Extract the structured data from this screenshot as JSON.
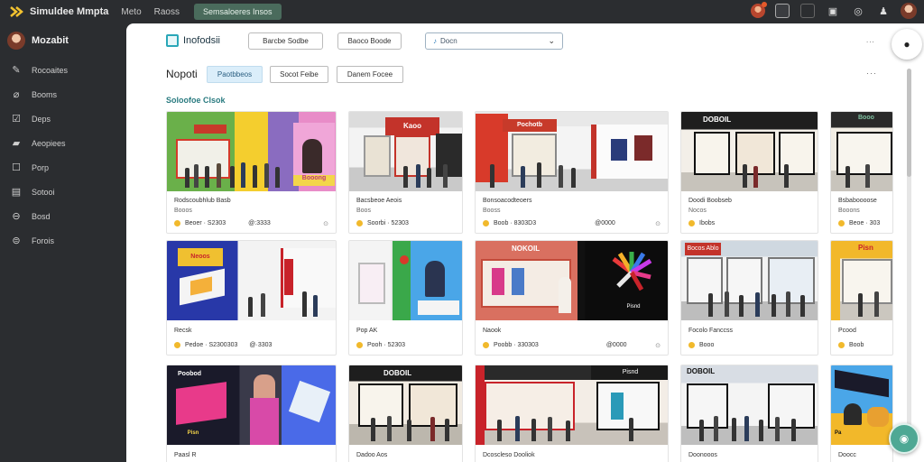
{
  "topbar": {
    "brand": "Simuldee Mmpta",
    "links": [
      "Meto",
      "Raoss"
    ],
    "pill": "Semsaloeres Insos"
  },
  "sidebar": {
    "user": "Mozabit",
    "items": [
      {
        "label": "Rocoaites",
        "icon": "edit-icon"
      },
      {
        "label": "Booms",
        "icon": "pin-icon"
      },
      {
        "label": "Deps",
        "icon": "checklist-icon"
      },
      {
        "label": "Aeopiees",
        "icon": "folder-icon"
      },
      {
        "label": "Porp",
        "icon": "square-icon"
      },
      {
        "label": "Sotooi",
        "icon": "calendar-icon"
      },
      {
        "label": "Bosd",
        "icon": "circle-icon"
      },
      {
        "label": "Forois",
        "icon": "settings-icon"
      }
    ]
  },
  "header": {
    "title": "Inofodsii",
    "btn1": "Barcbe Sodbe",
    "btn2": "Baoco Boode",
    "select_value": "Docn",
    "dots": "..."
  },
  "sub": {
    "title": "Nopoti",
    "tab1": "Paotbbeos",
    "tab2": "Socot Feibe",
    "tab3": "Danem Focee"
  },
  "section": "Soloofoe Clsok",
  "cards": [
    {
      "title": "Rodscoubhlub Basb",
      "sub": "Booos",
      "meta1": "Beoer · S2303",
      "meta2": "@:3333"
    },
    {
      "title": "Bacsbeoe Aeois",
      "sub": "Boos",
      "meta1": "Soorbi · 52303",
      "meta2": ""
    },
    {
      "title": "Bonsoacodteoers",
      "sub": "Booss",
      "meta1": "Boob · 8303D3",
      "meta2": "@0000"
    },
    {
      "title": "",
      "sub": "",
      "meta1": "",
      "meta2": ""
    },
    {
      "title": "Doodi Boobseb",
      "sub": "Nocos",
      "meta1": "Ibobs",
      "meta2": ""
    },
    {
      "title": "Bsbaboooose",
      "sub": "Booons",
      "meta1": "Beoe · 303",
      "meta2": ""
    },
    {
      "title": "Recsk",
      "sub": "",
      "meta1": "Pedoe · S2300303",
      "meta2": "@·3303"
    },
    {
      "title": "Pop AK",
      "sub": "",
      "meta1": "Pooh · 52303",
      "meta2": ""
    },
    {
      "title": "Naook",
      "sub": "",
      "meta1": "Poobb · 330303",
      "meta2": "@0000"
    },
    {
      "title": "",
      "sub": "",
      "meta1": "",
      "meta2": ""
    },
    {
      "title": "Focolo Fanccss",
      "sub": "",
      "meta1": "Booo",
      "meta2": ""
    },
    {
      "title": "Pcood",
      "sub": "",
      "meta1": "Boob",
      "meta2": ""
    },
    {
      "title": "Paasl R",
      "sub": "",
      "meta1": "",
      "meta2": ""
    },
    {
      "title": "Dadoo Aos",
      "sub": "",
      "meta1": "",
      "meta2": ""
    },
    {
      "title": "Dcoscleso Dooliok",
      "sub": "",
      "meta1": "",
      "meta2": ""
    },
    {
      "title": "",
      "sub": "",
      "meta1": "",
      "meta2": ""
    },
    {
      "title": "Doonooos",
      "sub": "",
      "meta1": "",
      "meta2": ""
    },
    {
      "title": "Doocc",
      "sub": "",
      "meta1": "",
      "meta2": ""
    }
  ],
  "thumb_text": {
    "t1": "Booong",
    "t11": "Bocos Ablo",
    "t13": "Poobod",
    "t2": "Kaoo",
    "t3": "Pochotb",
    "t5": "DOBOIL",
    "t6": "Booo",
    "t8": "Pisn",
    "t9": "NOKOIL",
    "t10": "Pisnd",
    "t12": "Pisn",
    "t14": "DOBOIL",
    "t15": "Pisnd",
    "t17": "DOBOIL",
    "t7": "Neoos",
    "t18": "Pa"
  },
  "colors": {
    "accent": "#4ea894",
    "link": "#2a7b80",
    "active_tab": "#dbeefa"
  }
}
